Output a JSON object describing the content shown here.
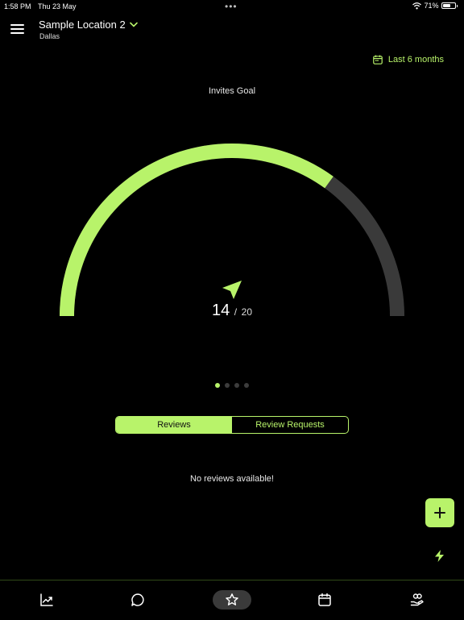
{
  "status_bar": {
    "time": "1:58 PM",
    "date": "Thu 23 May",
    "battery": "71%",
    "battery_level": 0.71
  },
  "header": {
    "location_name": "Sample Location 2",
    "location_city": "Dallas",
    "date_range": "Last 6 months"
  },
  "goal": {
    "title": "Invites Goal",
    "current": "14",
    "separator": "/",
    "target": "20",
    "progress": 0.7
  },
  "pager": {
    "count": 4,
    "active_index": 0
  },
  "segments": {
    "reviews": "Reviews",
    "review_requests": "Review Requests"
  },
  "content": {
    "empty_message": "No reviews available!"
  },
  "colors": {
    "accent": "#b8f36a",
    "track": "#3a3a3a",
    "background": "#000000"
  },
  "tabs": [
    {
      "icon": "analytics-chart-icon"
    },
    {
      "icon": "chat-bubble-icon"
    },
    {
      "icon": "star-icon",
      "active": true
    },
    {
      "icon": "calendar-icon"
    },
    {
      "icon": "hand-heart-icon"
    }
  ]
}
